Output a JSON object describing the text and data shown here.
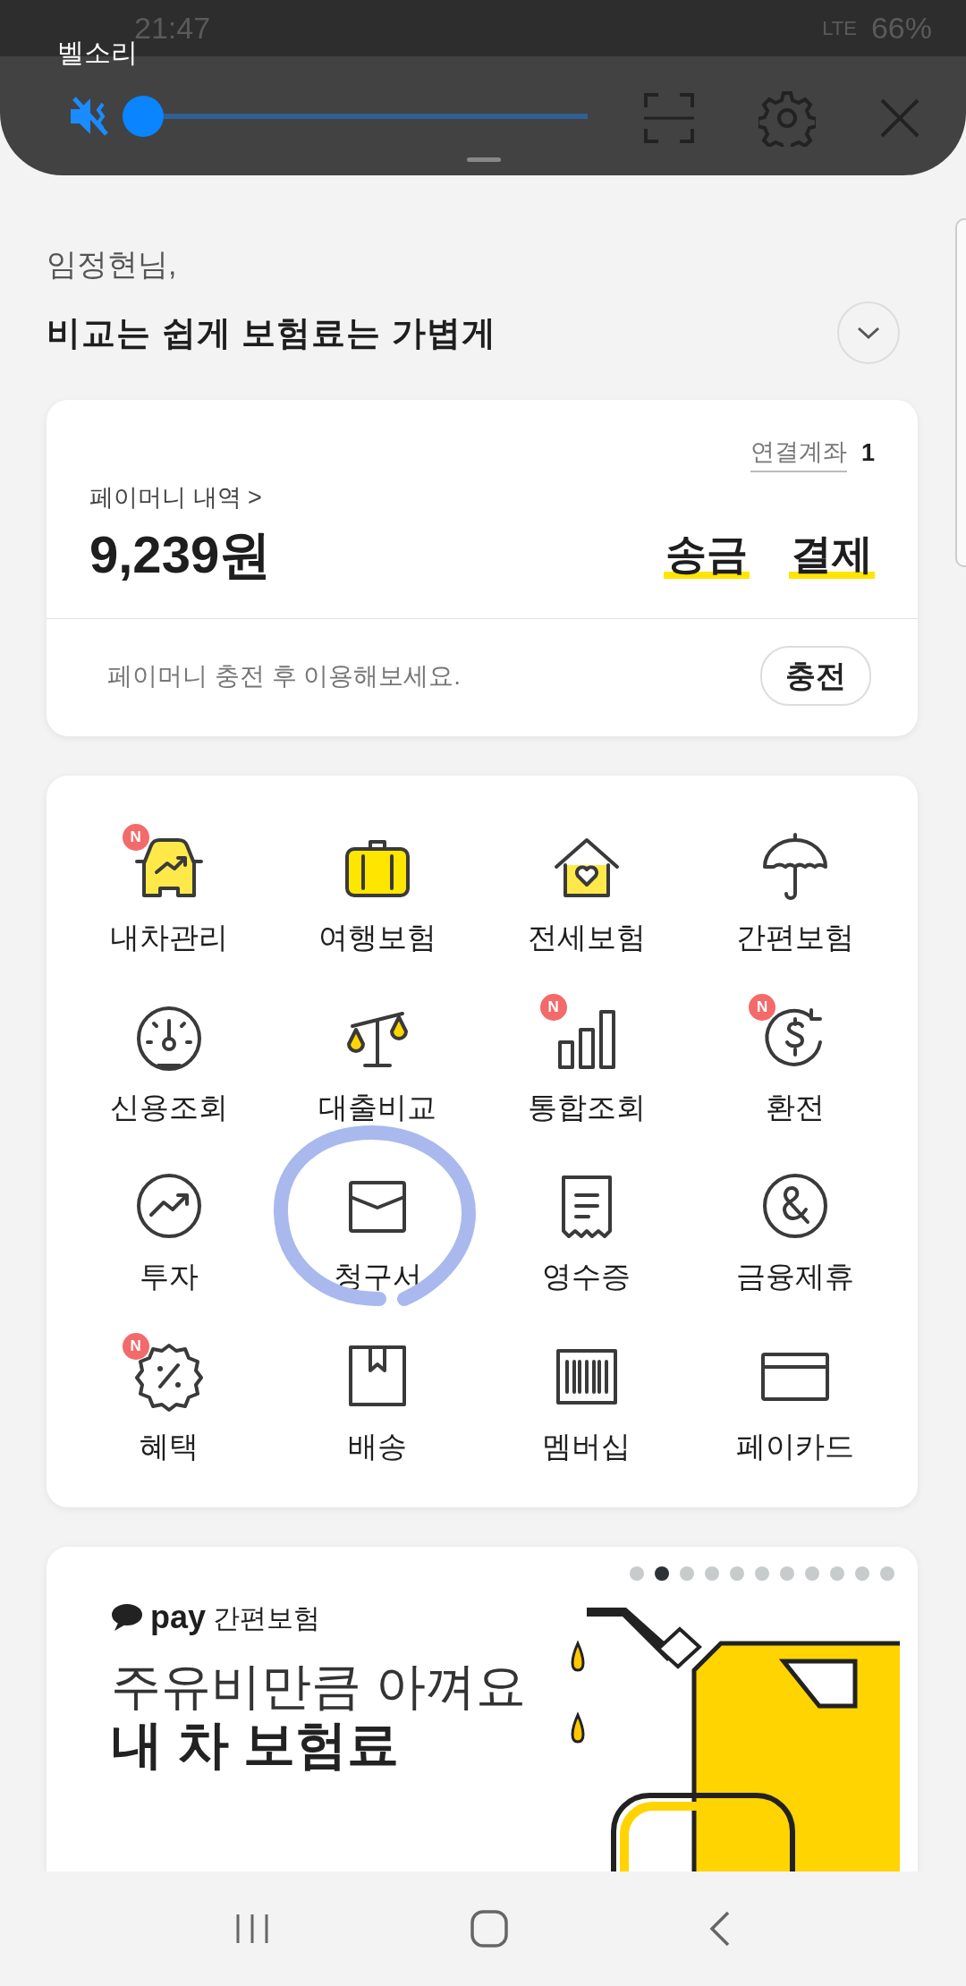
{
  "status_bar": {
    "time": "21:47",
    "network": "LTE",
    "battery": "66%"
  },
  "volume_panel": {
    "title": "벨소리",
    "muted": true,
    "level": 0.0
  },
  "greeting": {
    "name": "임정현님,",
    "headline": "비교는 쉽게 보험료는 가볍게"
  },
  "money_card": {
    "linked_account_label": "연결계좌",
    "linked_account_count": "1",
    "history_link": "페이머니 내역 >",
    "balance": "9,239원",
    "actions": [
      "송금",
      "결제"
    ],
    "hint": "페이머니 충전 후 이용해보세요.",
    "charge_button": "충전"
  },
  "menu": [
    {
      "label": "내차관리",
      "badge": "N"
    },
    {
      "label": "여행보험"
    },
    {
      "label": "전세보험"
    },
    {
      "label": "간편보험"
    },
    {
      "label": "신용조회"
    },
    {
      "label": "대출비교"
    },
    {
      "label": "통합조회",
      "badge": "N"
    },
    {
      "label": "환전",
      "badge": "N"
    },
    {
      "label": "투자"
    },
    {
      "label": "청구서",
      "circled": true
    },
    {
      "label": "영수증"
    },
    {
      "label": "금융제휴"
    },
    {
      "label": "혜택",
      "badge": "N"
    },
    {
      "label": "배송"
    },
    {
      "label": "멤버십"
    },
    {
      "label": "페이카드"
    }
  ],
  "banner": {
    "brand": "pay",
    "product": "간편보험",
    "line_1": "주유비만큼 아껴요",
    "line_2": "내 차 보험료",
    "pages": [
      {
        "selected": false
      },
      {
        "selected": true
      },
      {
        "selected": false
      },
      {
        "selected": false
      },
      {
        "selected": false
      },
      {
        "selected": false
      },
      {
        "selected": false
      },
      {
        "selected": false
      },
      {
        "selected": false
      },
      {
        "selected": false
      },
      {
        "selected": false
      }
    ]
  }
}
